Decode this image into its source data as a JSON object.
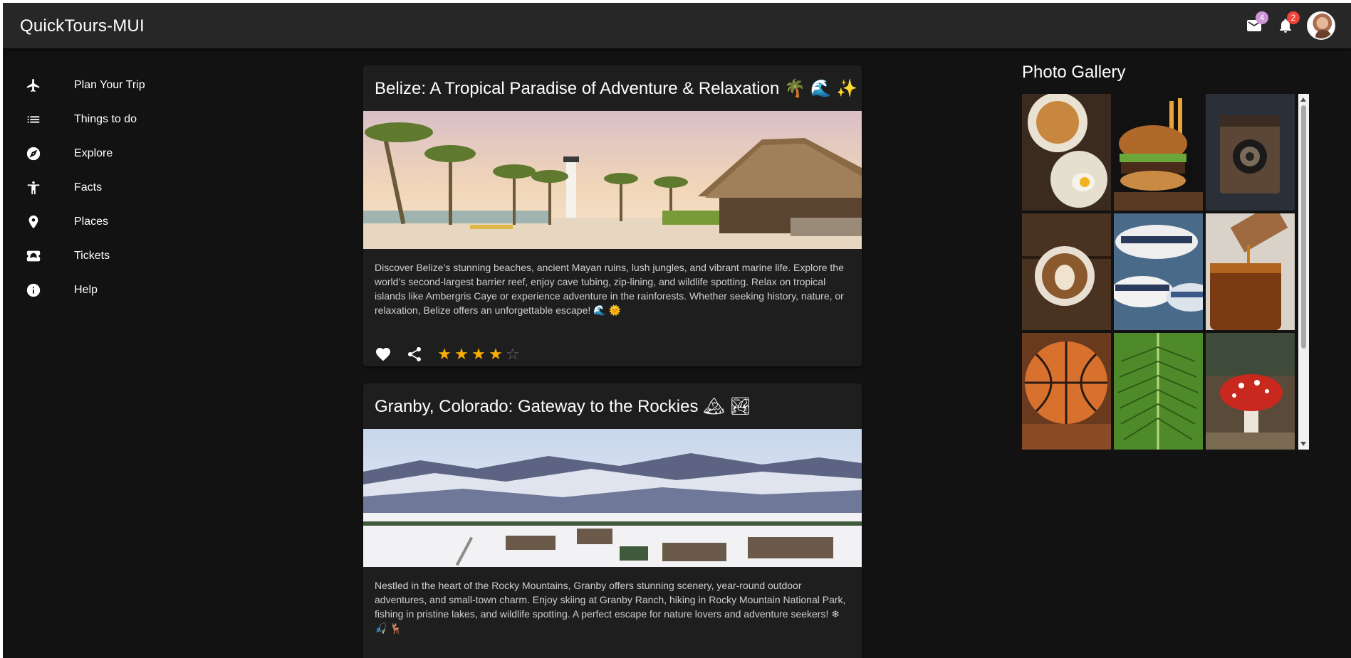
{
  "app": {
    "title": "QuickTours-MUI"
  },
  "header": {
    "mail_badge": "4",
    "notifications_badge": "2",
    "icons": [
      "mail-icon",
      "notifications-icon",
      "avatar"
    ],
    "colors": {
      "appbar": "#272727",
      "mail_badge": "#ce93d8",
      "notifications_badge": "#f44336"
    }
  },
  "sidebar": {
    "items": [
      {
        "label": "Plan Your Trip",
        "icon": "airplane-icon"
      },
      {
        "label": "Things to do",
        "icon": "list-icon"
      },
      {
        "label": "Explore",
        "icon": "compass-icon"
      },
      {
        "label": "Facts",
        "icon": "accessibility-icon"
      },
      {
        "label": "Places",
        "icon": "place-icon"
      },
      {
        "label": "Tickets",
        "icon": "ticket-icon"
      },
      {
        "label": "Help",
        "icon": "info-icon"
      }
    ]
  },
  "cards": [
    {
      "title": "Belize: A Tropical Paradise of Adventure & Relaxation 🌴 🌊 ✨",
      "image": "beach-with-palm-trees-lighthouse-and-thatched-hut",
      "description": "Discover Belize’s stunning beaches, ancient Mayan ruins, lush jungles, and vibrant marine life. Explore the world’s second-largest barrier reef, enjoy cave tubing, zip-lining, and wildlife spotting. Relax on tropical islands like Ambergris Caye or experience adventure in the rainforests. Whether seeking history, nature, or relaxation, Belize offers an unforgettable escape! 🌊 🌞",
      "rating": 4,
      "rating_max": 5
    },
    {
      "title": "Granby, Colorado: Gateway to the Rockies 🏔 🏞",
      "image": "snowy-mountain-town",
      "description": "Nestled in the heart of the Rocky Mountains, Granby offers stunning scenery, year-round outdoor adventures, and small-town charm. Enjoy skiing at Granby Ranch, hiking in Rocky Mountain National Park, fishing in pristine lakes, and wildlife spotting. A perfect escape for nature lovers and adventure seekers! ❄ 🎣 🦌"
    }
  ],
  "gallery": {
    "title": "Photo Gallery",
    "images": [
      "breakfast",
      "burger",
      "camera",
      "coffee",
      "hats",
      "honey",
      "basketball",
      "fern",
      "mushroom"
    ]
  },
  "colors": {
    "background": "#121212",
    "card": "#1e1e1e",
    "star": "#faaf00"
  }
}
